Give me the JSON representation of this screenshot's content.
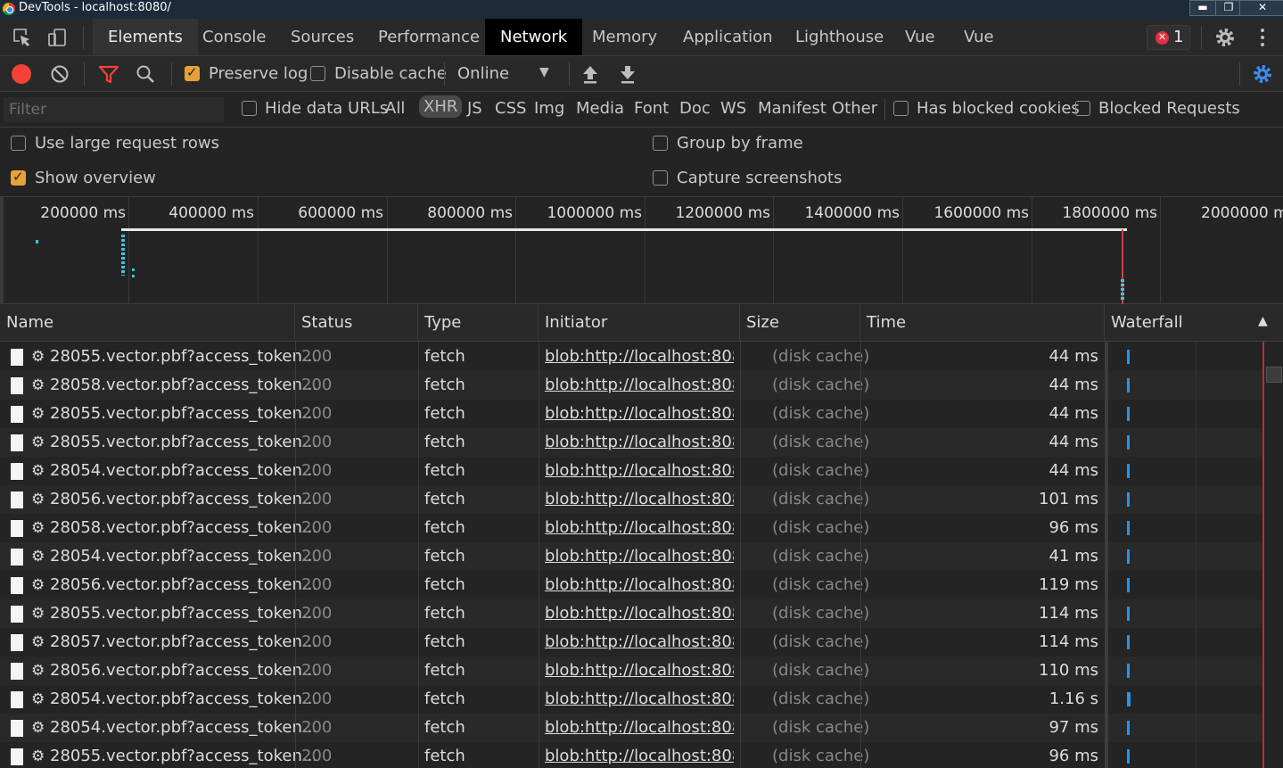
{
  "window": {
    "title": "DevTools - localhost:8080/",
    "buttons": [
      "▬",
      "❐",
      "✕"
    ]
  },
  "tabs": {
    "items": [
      "Elements",
      "Console",
      "Sources",
      "Performance",
      "Network",
      "Memory",
      "Application",
      "Lighthouse",
      "Vue",
      "Vue"
    ],
    "active": "Network",
    "error_count": "1"
  },
  "toolbar": {
    "preserve_log": "Preserve log",
    "preserve_log_checked": true,
    "disable_cache": "Disable cache",
    "disable_cache_checked": false,
    "throttle": "Online",
    "record_color": "#f44336",
    "filter_color": "#f44336",
    "settings_color": "#3b8ff0"
  },
  "filter": {
    "placeholder": "Filter",
    "hide_data_urls": "Hide data URLs",
    "types": [
      "All",
      "XHR",
      "JS",
      "CSS",
      "Img",
      "Media",
      "Font",
      "Doc",
      "WS",
      "Manifest",
      "Other"
    ],
    "active_type": "XHR",
    "has_blocked_cookies": "Has blocked cookies",
    "blocked_requests": "Blocked Requests"
  },
  "options": {
    "large_rows": "Use large request rows",
    "large_rows_checked": false,
    "show_overview": "Show overview",
    "show_overview_checked": true,
    "group_by_frame": "Group by frame",
    "group_by_frame_checked": false,
    "capture_screenshots": "Capture screenshots",
    "capture_screenshots_checked": false
  },
  "overview": {
    "ticks": [
      "200000 ms",
      "400000 ms",
      "600000 ms",
      "800000 ms",
      "1000000 ms",
      "1200000 ms",
      "1400000 ms",
      "1600000 ms",
      "1800000 ms",
      "2000000 m"
    ]
  },
  "table": {
    "columns": [
      "Name",
      "Status",
      "Type",
      "Initiator",
      "Size",
      "Time",
      "Waterfall"
    ],
    "sort_indicator": "▲",
    "rows": [
      {
        "name": "28055.vector.pbf?access_token...",
        "status": "200",
        "type": "fetch",
        "initiator": "blob:http://localhost:808...",
        "size": "(disk cache)",
        "time": "44 ms"
      },
      {
        "name": "28058.vector.pbf?access_token...",
        "status": "200",
        "type": "fetch",
        "initiator": "blob:http://localhost:808...",
        "size": "(disk cache)",
        "time": "44 ms"
      },
      {
        "name": "28055.vector.pbf?access_token...",
        "status": "200",
        "type": "fetch",
        "initiator": "blob:http://localhost:808...",
        "size": "(disk cache)",
        "time": "44 ms"
      },
      {
        "name": "28055.vector.pbf?access_token...",
        "status": "200",
        "type": "fetch",
        "initiator": "blob:http://localhost:808...",
        "size": "(disk cache)",
        "time": "44 ms"
      },
      {
        "name": "28054.vector.pbf?access_token...",
        "status": "200",
        "type": "fetch",
        "initiator": "blob:http://localhost:808...",
        "size": "(disk cache)",
        "time": "44 ms"
      },
      {
        "name": "28056.vector.pbf?access_token...",
        "status": "200",
        "type": "fetch",
        "initiator": "blob:http://localhost:808...",
        "size": "(disk cache)",
        "time": "101 ms"
      },
      {
        "name": "28058.vector.pbf?access_token...",
        "status": "200",
        "type": "fetch",
        "initiator": "blob:http://localhost:808...",
        "size": "(disk cache)",
        "time": "96 ms"
      },
      {
        "name": "28054.vector.pbf?access_token...",
        "status": "200",
        "type": "fetch",
        "initiator": "blob:http://localhost:808...",
        "size": "(disk cache)",
        "time": "41 ms"
      },
      {
        "name": "28056.vector.pbf?access_token...",
        "status": "200",
        "type": "fetch",
        "initiator": "blob:http://localhost:808...",
        "size": "(disk cache)",
        "time": "119 ms"
      },
      {
        "name": "28055.vector.pbf?access_token...",
        "status": "200",
        "type": "fetch",
        "initiator": "blob:http://localhost:808...",
        "size": "(disk cache)",
        "time": "114 ms"
      },
      {
        "name": "28057.vector.pbf?access_token...",
        "status": "200",
        "type": "fetch",
        "initiator": "blob:http://localhost:808...",
        "size": "(disk cache)",
        "time": "114 ms"
      },
      {
        "name": "28056.vector.pbf?access_token...",
        "status": "200",
        "type": "fetch",
        "initiator": "blob:http://localhost:808...",
        "size": "(disk cache)",
        "time": "110 ms"
      },
      {
        "name": "28054.vector.pbf?access_token...",
        "status": "200",
        "type": "fetch",
        "initiator": "blob:http://localhost:808...",
        "size": "(disk cache)",
        "time": "1.16 s"
      },
      {
        "name": "28054.vector.pbf?access_token...",
        "status": "200",
        "type": "fetch",
        "initiator": "blob:http://localhost:808...",
        "size": "(disk cache)",
        "time": "97 ms"
      },
      {
        "name": "28055.vector.pbf?access_token...",
        "status": "200",
        "type": "fetch",
        "initiator": "blob:http://localhost:808...",
        "size": "(disk cache)",
        "time": "96 ms"
      }
    ]
  }
}
